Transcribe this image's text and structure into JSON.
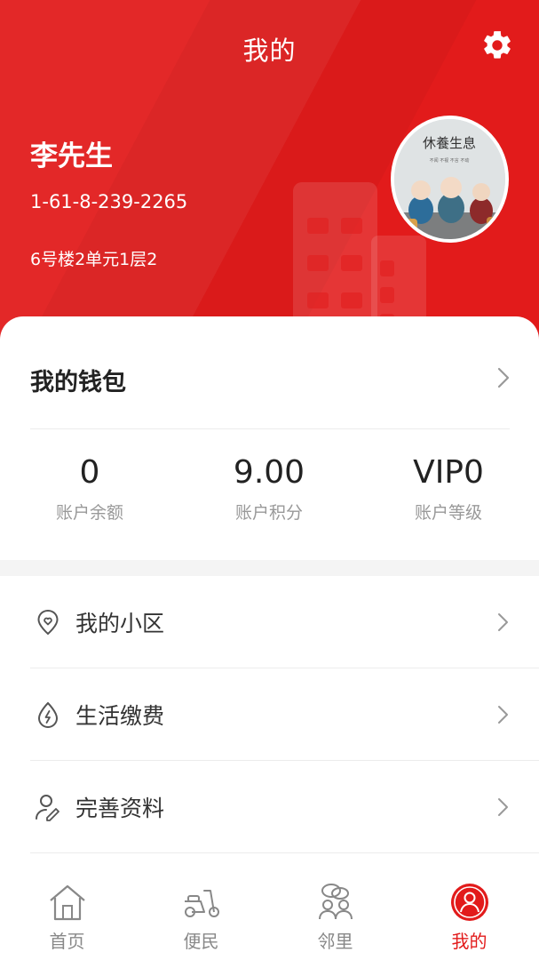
{
  "header": {
    "title": "我的",
    "settings_icon": "gear-icon",
    "accent_color": "#e21b1b"
  },
  "profile": {
    "name": "李先生",
    "phone": "1-61-8-239-2265",
    "address": "6号楼2单元1层2",
    "avatar_caption": "休養生息",
    "avatar_subcaption": "不闻 不视 不言 不动"
  },
  "wallet": {
    "title": "我的钱包",
    "stats": [
      {
        "value": "0",
        "label": "账户余额"
      },
      {
        "value": "9.00",
        "label": "账户积分"
      },
      {
        "value": "VIP0",
        "label": "账户等级"
      }
    ]
  },
  "menu": {
    "items": [
      {
        "label": "我的小区",
        "icon": "location-pin-heart-icon"
      },
      {
        "label": "生活缴费",
        "icon": "energy-bolt-icon"
      },
      {
        "label": "完善资料",
        "icon": "profile-edit-icon"
      }
    ]
  },
  "nav": {
    "items": [
      {
        "label": "首页",
        "icon": "home-icon",
        "active": false
      },
      {
        "label": "便民",
        "icon": "scooter-icon",
        "active": false
      },
      {
        "label": "邻里",
        "icon": "neighbors-icon",
        "active": false
      },
      {
        "label": "我的",
        "icon": "user-icon",
        "active": true
      }
    ],
    "active_color": "#e21b1b",
    "inactive_color": "#888888"
  }
}
